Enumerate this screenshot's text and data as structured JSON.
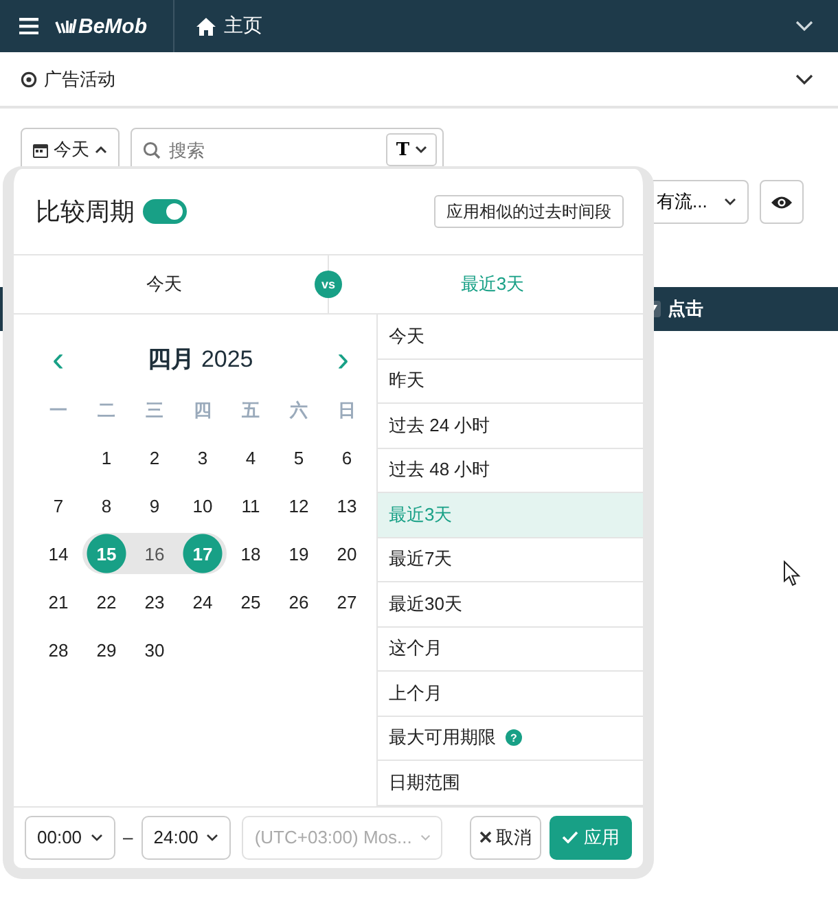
{
  "topbar": {
    "logo": "BeMob",
    "home": "主页"
  },
  "section": {
    "title": "广告活动"
  },
  "toolbar": {
    "date_button": "今天",
    "search": {
      "placeholder": "搜索"
    },
    "type_button": "T",
    "traffic_filter": "有流...",
    "table_header_visible": "点击"
  },
  "popover": {
    "title": "比较周期",
    "compare_on": true,
    "similar_button": "应用相似的过去时间段",
    "compare": {
      "left": "今天",
      "vs": "vs",
      "right": "最近3天"
    },
    "calendar": {
      "month": "四月",
      "year": "2025",
      "prev": "‹",
      "next": "›",
      "weekdays": [
        "一",
        "二",
        "三",
        "四",
        "五",
        "六",
        "日"
      ],
      "weeks": [
        [
          {
            "day": "1",
            "selected": false,
            "in_range": false
          },
          {
            "day": "2",
            "selected": false,
            "in_range": false
          },
          {
            "day": "3",
            "selected": false,
            "in_range": false
          },
          {
            "day": "4",
            "selected": false,
            "in_range": false
          },
          {
            "day": "5",
            "selected": false,
            "in_range": false
          },
          {
            "day": "6",
            "selected": false,
            "in_range": false
          }
        ],
        [
          {
            "day": "7",
            "selected": false,
            "in_range": false
          },
          {
            "day": "8",
            "selected": false,
            "in_range": false
          },
          {
            "day": "9",
            "selected": false,
            "in_range": false
          },
          {
            "day": "10",
            "selected": false,
            "in_range": false
          },
          {
            "day": "11",
            "selected": false,
            "in_range": false
          },
          {
            "day": "12",
            "selected": false,
            "in_range": false
          },
          {
            "day": "13",
            "selected": false,
            "in_range": false
          }
        ],
        [
          {
            "day": "14",
            "selected": false,
            "in_range": false
          },
          {
            "day": "15",
            "selected": true,
            "in_range": true
          },
          {
            "day": "16",
            "selected": false,
            "in_range": true
          },
          {
            "day": "17",
            "selected": true,
            "in_range": true
          },
          {
            "day": "18",
            "selected": false,
            "in_range": false
          },
          {
            "day": "19",
            "selected": false,
            "in_range": false
          },
          {
            "day": "20",
            "selected": false,
            "in_range": false
          }
        ],
        [
          {
            "day": "21",
            "selected": false,
            "in_range": false
          },
          {
            "day": "22",
            "selected": false,
            "in_range": false
          },
          {
            "day": "23",
            "selected": false,
            "in_range": false
          },
          {
            "day": "24",
            "selected": false,
            "in_range": false
          },
          {
            "day": "25",
            "selected": false,
            "in_range": false
          },
          {
            "day": "26",
            "selected": false,
            "in_range": false
          },
          {
            "day": "27",
            "selected": false,
            "in_range": false
          }
        ],
        [
          {
            "day": "28",
            "selected": false,
            "in_range": false
          },
          {
            "day": "29",
            "selected": false,
            "in_range": false
          },
          {
            "day": "30",
            "selected": false,
            "in_range": false
          }
        ]
      ]
    },
    "presets": [
      {
        "label": "今天",
        "selected": false
      },
      {
        "label": "昨天",
        "selected": false
      },
      {
        "label": "过去 24 小时",
        "selected": false
      },
      {
        "label": "过去 48 小时",
        "selected": false
      },
      {
        "label": "最近3天",
        "selected": true
      },
      {
        "label": "最近7天",
        "selected": false
      },
      {
        "label": "最近30天",
        "selected": false
      },
      {
        "label": "这个月",
        "selected": false
      },
      {
        "label": "上个月",
        "selected": false
      },
      {
        "label": "最大可用期限",
        "selected": false,
        "help": "?"
      },
      {
        "label": "日期范围",
        "selected": false
      }
    ],
    "footer": {
      "from": "00:00",
      "dash": "–",
      "to": "24:00",
      "timezone": "(UTC+03:00) Mos...",
      "timezone_disabled": true,
      "cancel": "取消",
      "apply": "应用"
    }
  }
}
